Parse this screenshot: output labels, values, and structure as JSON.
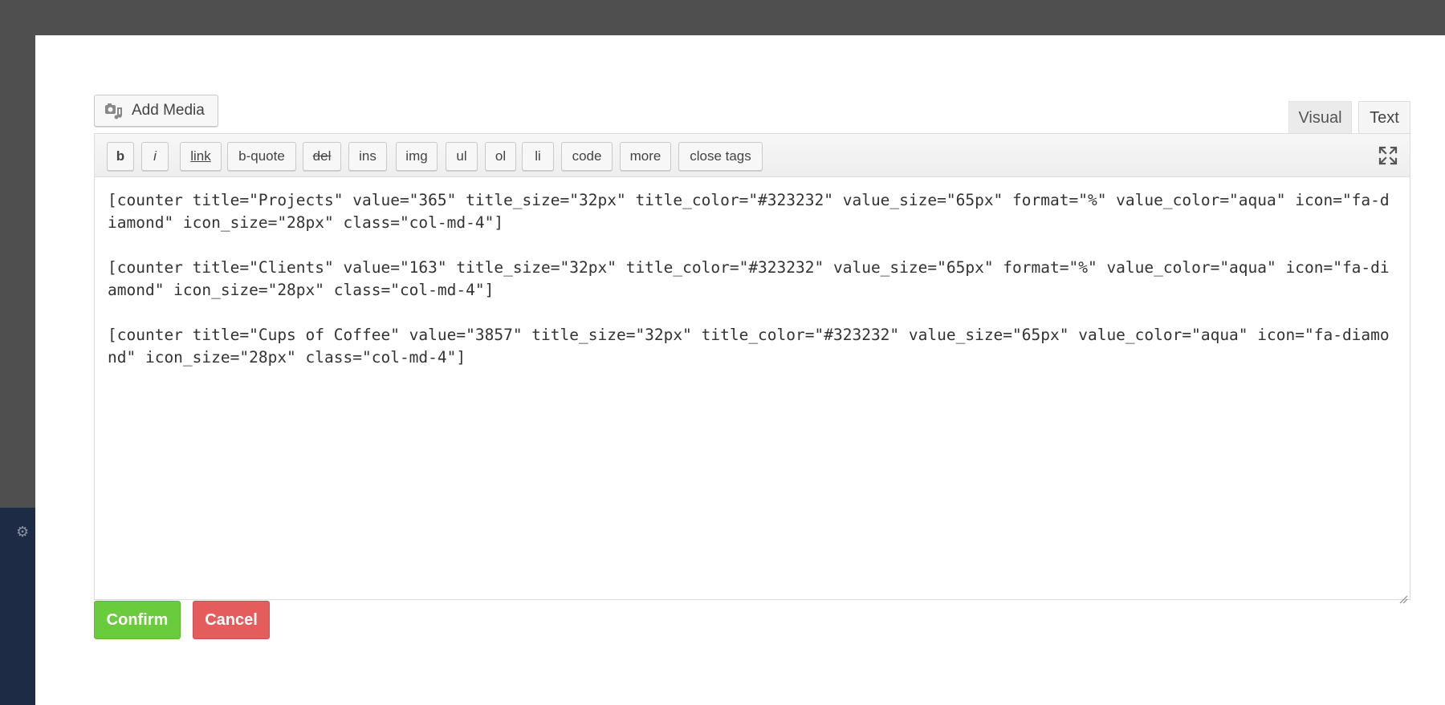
{
  "add_media": {
    "label": "Add Media",
    "icon": "camera-music-icon"
  },
  "tabs": [
    {
      "label": "Visual"
    },
    {
      "label": "Text"
    }
  ],
  "toolbar": {
    "buttons": [
      {
        "label": "b"
      },
      {
        "label": "i"
      },
      {
        "label": "link"
      },
      {
        "label": "b-quote"
      },
      {
        "label": "del"
      },
      {
        "label": "ins"
      },
      {
        "label": "img"
      },
      {
        "label": "ul"
      },
      {
        "label": "ol"
      },
      {
        "label": "li"
      },
      {
        "label": "code"
      },
      {
        "label": "more"
      },
      {
        "label": "close tags"
      }
    ],
    "fullscreen_icon": "fullscreen-icon"
  },
  "editor": {
    "lines": [
      "[counter title=\"Projects\" value=\"365\" title_size=\"32px\" title_color=\"#323232\" value_size=\"65px\" format=\"%\" value_color=\"aqua\" icon=\"fa-diamond\" icon_size=\"28px\" class=\"col-md-4\"]",
      "[counter title=\"Clients\" value=\"163\" title_size=\"32px\" title_color=\"#323232\" value_size=\"65px\" format=\"%\" value_color=\"aqua\" icon=\"fa-diamond\" icon_size=\"28px\" class=\"col-md-4\"]",
      "[counter title=\"Cups of Coffee\" value=\"3857\" title_size=\"32px\" title_color=\"#323232\" value_size=\"65px\" value_color=\"aqua\" icon=\"fa-diamond\" icon_size=\"28px\" class=\"col-md-4\"]"
    ]
  },
  "actions": {
    "confirm": "Confirm",
    "cancel": "Cancel"
  },
  "colors": {
    "confirm": "#6acb3c",
    "cancel": "#e55c5c",
    "overlay": "#4f4f4f",
    "sidebar": "#1d2b45"
  }
}
